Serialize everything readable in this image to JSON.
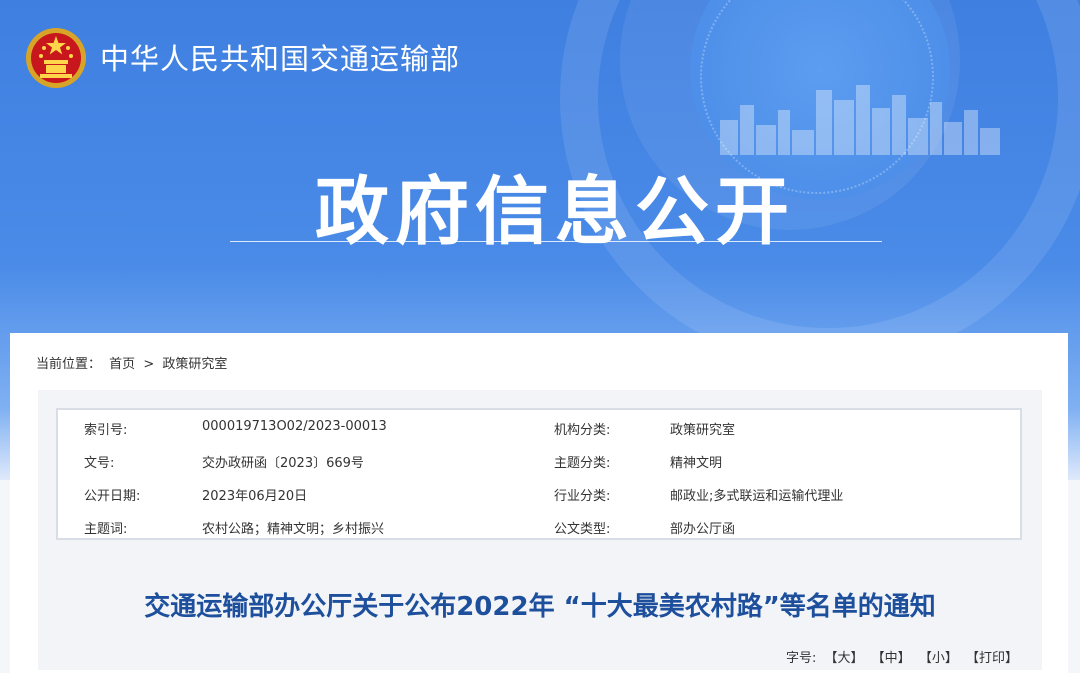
{
  "header": {
    "site_name": "中华人民共和国交通运输部",
    "section_title": "政府信息公开"
  },
  "breadcrumb": {
    "label": "当前位置：",
    "home": "首页",
    "separator": ">",
    "current": "政策研究室"
  },
  "meta": {
    "index_label": "索引号:",
    "index_value": "000019713O02/2023-00013",
    "org_label": "机构分类:",
    "org_value": "政策研究室",
    "docno_label": "文号:",
    "docno_value": "交办政研函〔2023〕669号",
    "topic_label": "主题分类:",
    "topic_value": "精神文明",
    "date_label": "公开日期:",
    "date_value": "2023年06月20日",
    "industry_label": "行业分类:",
    "industry_value": "邮政业;多式联运和运输代理业",
    "keywords_label": "主题词:",
    "keywords_value": "农村公路；精神文明；乡村振兴",
    "doctype_label": "公文类型:",
    "doctype_value": "部办公厅函"
  },
  "document": {
    "title": "交通运输部办公厅关于公布2022年 “十大最美农村路”等名单的通知"
  },
  "font_size": {
    "label": "字号:",
    "large": "【大】",
    "medium": "【中】",
    "small": "【小】",
    "print": "【打印】"
  },
  "colors": {
    "banner_blue": "#4a8be8",
    "title_blue": "#1d4f9c"
  }
}
